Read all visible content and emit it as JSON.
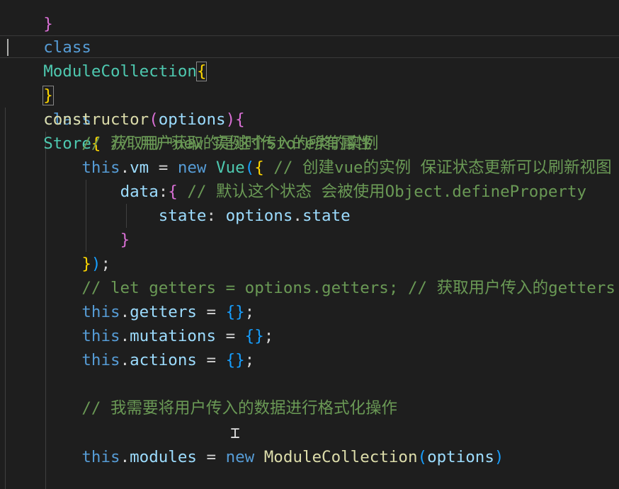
{
  "code": {
    "l0": {
      "brace": "}"
    },
    "l1": {
      "kw": "class",
      "name": "ModuleCollection",
      "brace": "{"
    },
    "l3": {
      "brace": "}"
    },
    "l4": {
      "kw": "class",
      "name": "Store",
      "brace": "{",
      "comment": " // 用户获取的是这个Store类的实例"
    },
    "l5": {
      "fn": "constructor",
      "open": "(",
      "param": "options",
      "close": ")",
      "brace": "{"
    },
    "l6": {
      "comment": "// 获取用户new 实例时传入的所有属性"
    },
    "l7": {
      "this": "this",
      "dot": ".",
      "prop": "vm",
      "op": " = ",
      "new": "new",
      "sp": " ",
      "cls": "Vue",
      "paren": "(",
      "brace": "{",
      "comment": " // 创建vue的实例 保证状态更新可以刷新视图"
    },
    "l8": {
      "key": "data",
      "colon": ":",
      "brace": "{",
      "comment": " // 默认这个状态 会被使用Object.defineProperty"
    },
    "l9": {
      "key": "state",
      "colon": ": ",
      "obj": "options",
      "dot": ".",
      "prop": "state"
    },
    "l10": {
      "brace": "}"
    },
    "l11": {
      "brace": "}",
      "paren": ")",
      "semi": ";"
    },
    "l12": {
      "comment": "// let getters = options.getters; // 获取用户传入的getters"
    },
    "l13": {
      "this": "this",
      "dot": ".",
      "prop": "getters",
      "op": " = ",
      "open": "{",
      "close": "}",
      "semi": ";"
    },
    "l14": {
      "this": "this",
      "dot": ".",
      "prop": "mutations",
      "op": " = ",
      "open": "{",
      "close": "}",
      "semi": ";"
    },
    "l15": {
      "this": "this",
      "dot": ".",
      "prop": "actions",
      "op": " = ",
      "open": "{",
      "close": "}",
      "semi": ";"
    },
    "l17": {
      "comment": "// 我需要将用户传入的数据进行格式化操作"
    },
    "l19": {
      "this": "this",
      "dot": ".",
      "prop": "modules",
      "op": " = ",
      "new": "new",
      "sp": " ",
      "cls": "ModuleCollection",
      "open": "(",
      "arg": "options",
      "close": ")"
    }
  },
  "colors": {
    "background": "#1e1e1e",
    "keyword": "#569cd6",
    "class_name": "#4ec9b0",
    "function": "#dcdcaa",
    "variable": "#9cdcfe",
    "comment": "#6a9955",
    "bracket_level1": "#ffd700",
    "bracket_level2": "#da70d6",
    "bracket_level3": "#179fff"
  }
}
